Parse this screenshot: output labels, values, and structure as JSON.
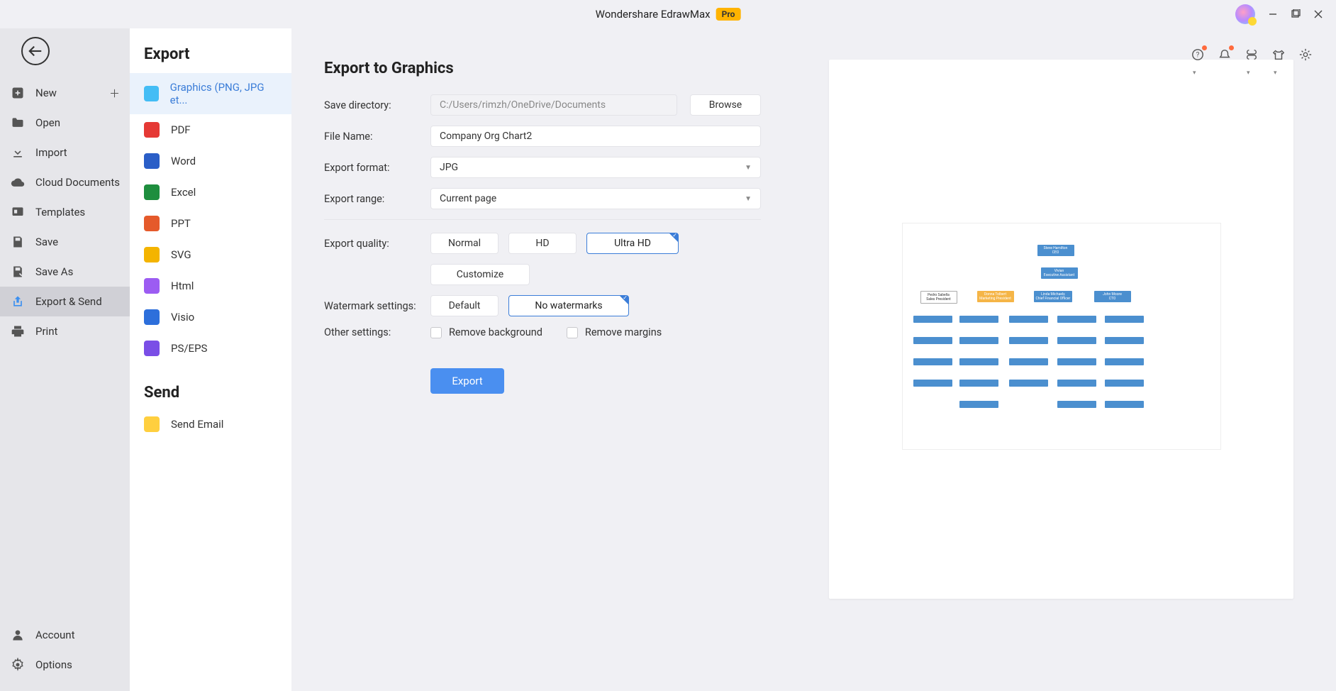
{
  "titlebar": {
    "app_name": "Wondershare EdrawMax",
    "badge": "Pro"
  },
  "leftnav": {
    "items": [
      {
        "label": "New",
        "icon": "plus-square",
        "trailing_plus": true
      },
      {
        "label": "Open",
        "icon": "folder"
      },
      {
        "label": "Import",
        "icon": "import"
      },
      {
        "label": "Cloud Documents",
        "icon": "cloud"
      },
      {
        "label": "Templates",
        "icon": "templates"
      },
      {
        "label": "Save",
        "icon": "save"
      },
      {
        "label": "Save As",
        "icon": "save-as"
      },
      {
        "label": "Export & Send",
        "icon": "export",
        "active": true
      },
      {
        "label": "Print",
        "icon": "print"
      }
    ],
    "footer": [
      {
        "label": "Account",
        "icon": "person"
      },
      {
        "label": "Options",
        "icon": "gear"
      }
    ]
  },
  "midnav": {
    "export_header": "Export",
    "export_items": [
      {
        "label": "Graphics (PNG, JPG et...",
        "color": "#44bdf5",
        "selected": true
      },
      {
        "label": "PDF",
        "color": "#e53935"
      },
      {
        "label": "Word",
        "color": "#2a5ec7"
      },
      {
        "label": "Excel",
        "color": "#1e8e3e"
      },
      {
        "label": "PPT",
        "color": "#e55a2b"
      },
      {
        "label": "SVG",
        "color": "#f4b400"
      },
      {
        "label": "Html",
        "color": "#9c5cf2"
      },
      {
        "label": "Visio",
        "color": "#2d6fdb"
      },
      {
        "label": "PS/EPS",
        "color": "#7a4ee6"
      }
    ],
    "send_header": "Send",
    "send_items": [
      {
        "label": "Send Email",
        "color": "#ffcf3f"
      }
    ]
  },
  "form": {
    "heading": "Export to Graphics",
    "save_dir_label": "Save directory:",
    "save_dir_value": "C:/Users/rimzh/OneDrive/Documents",
    "browse": "Browse",
    "file_name_label": "File Name:",
    "file_name_value": "Company Org Chart2",
    "export_format_label": "Export format:",
    "export_format_value": "JPG",
    "export_range_label": "Export range:",
    "export_range_value": "Current page",
    "export_quality_label": "Export quality:",
    "quality_options": [
      "Normal",
      "HD",
      "Ultra HD"
    ],
    "quality_selected": "Ultra HD",
    "customize": "Customize",
    "watermark_label": "Watermark settings:",
    "watermark_options": [
      "Default",
      "No watermarks"
    ],
    "watermark_selected": "No watermarks",
    "other_settings_label": "Other settings:",
    "checkbox_remove_bg": "Remove background",
    "checkbox_remove_margins": "Remove margins",
    "export_button": "Export"
  }
}
